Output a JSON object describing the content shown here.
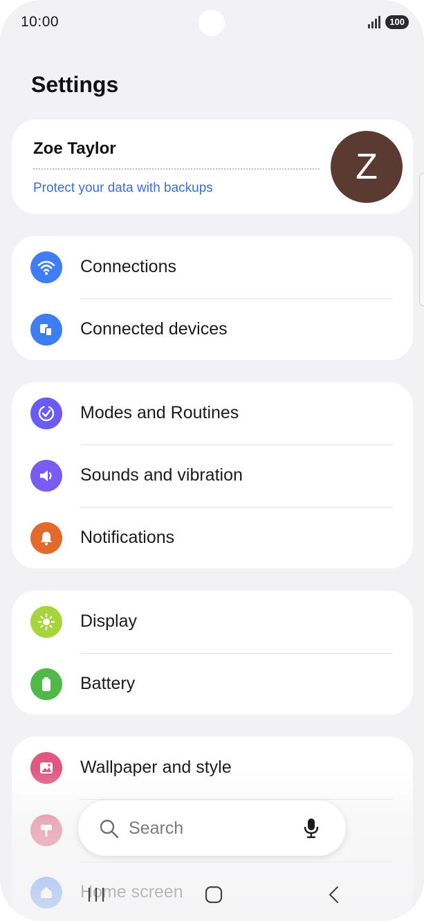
{
  "status_bar": {
    "time": "10:00",
    "battery": "100"
  },
  "page_title": "Settings",
  "profile": {
    "name": "Zoe Taylor",
    "link": "Protect your data with backups",
    "avatar_letter": "Z",
    "avatar_color": "#5b3a31"
  },
  "groups": [
    {
      "items": [
        {
          "label": "Connections",
          "icon": "wifi-icon",
          "color": "#3f7ef2"
        },
        {
          "label": "Connected devices",
          "icon": "connected-devices-icon",
          "color": "#3f7ef2"
        }
      ]
    },
    {
      "items": [
        {
          "label": "Modes and Routines",
          "icon": "check-circle-icon",
          "color": "#6a5cf0"
        },
        {
          "label": "Sounds and vibration",
          "icon": "volume-icon",
          "color": "#7a5cf2"
        },
        {
          "label": "Notifications",
          "icon": "bell-icon",
          "color": "#e36a2d"
        }
      ]
    },
    {
      "items": [
        {
          "label": "Display",
          "icon": "sun-icon",
          "color": "#a7d43c"
        },
        {
          "label": "Battery",
          "icon": "battery-icon",
          "color": "#52b84a"
        }
      ]
    },
    {
      "items": [
        {
          "label": "Wallpaper and style",
          "icon": "image-icon",
          "color": "#e0577f"
        },
        {
          "label": "",
          "icon": "paint-roller-icon",
          "color": "#e0577f"
        },
        {
          "label": "Home screen",
          "icon": "home-icon",
          "color": "#3f7ef2"
        }
      ]
    }
  ],
  "search": {
    "placeholder": "Search"
  },
  "colors": {
    "background": "#f2f2f4",
    "link": "#3e6ec9"
  }
}
